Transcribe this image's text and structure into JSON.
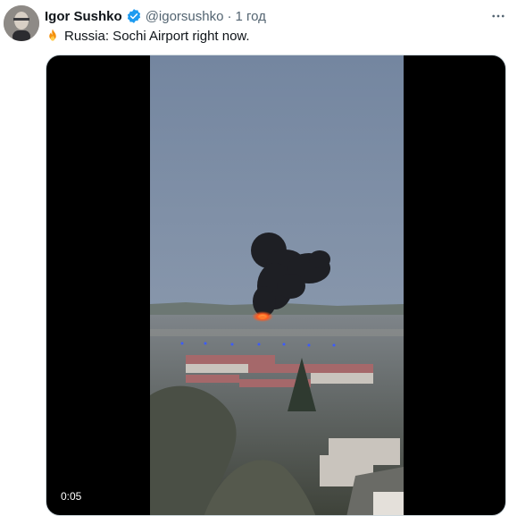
{
  "tweet": {
    "author_name": "Igor Sushko",
    "handle": "@igorsushko",
    "separator": "·",
    "time": "1 год",
    "text": "Russia: Sochi Airport right now.",
    "emoji_icon": "fire-icon",
    "verified_icon": "verified-badge-icon",
    "more_icon": "more-options-icon"
  },
  "media": {
    "type": "video",
    "duration": "0:05"
  },
  "colors": {
    "verified": "#1d9bf0",
    "secondary_text": "#536471",
    "sky": "#7e8ea3",
    "smoke": "#1e1f24",
    "fire": "#ff5a1f"
  }
}
